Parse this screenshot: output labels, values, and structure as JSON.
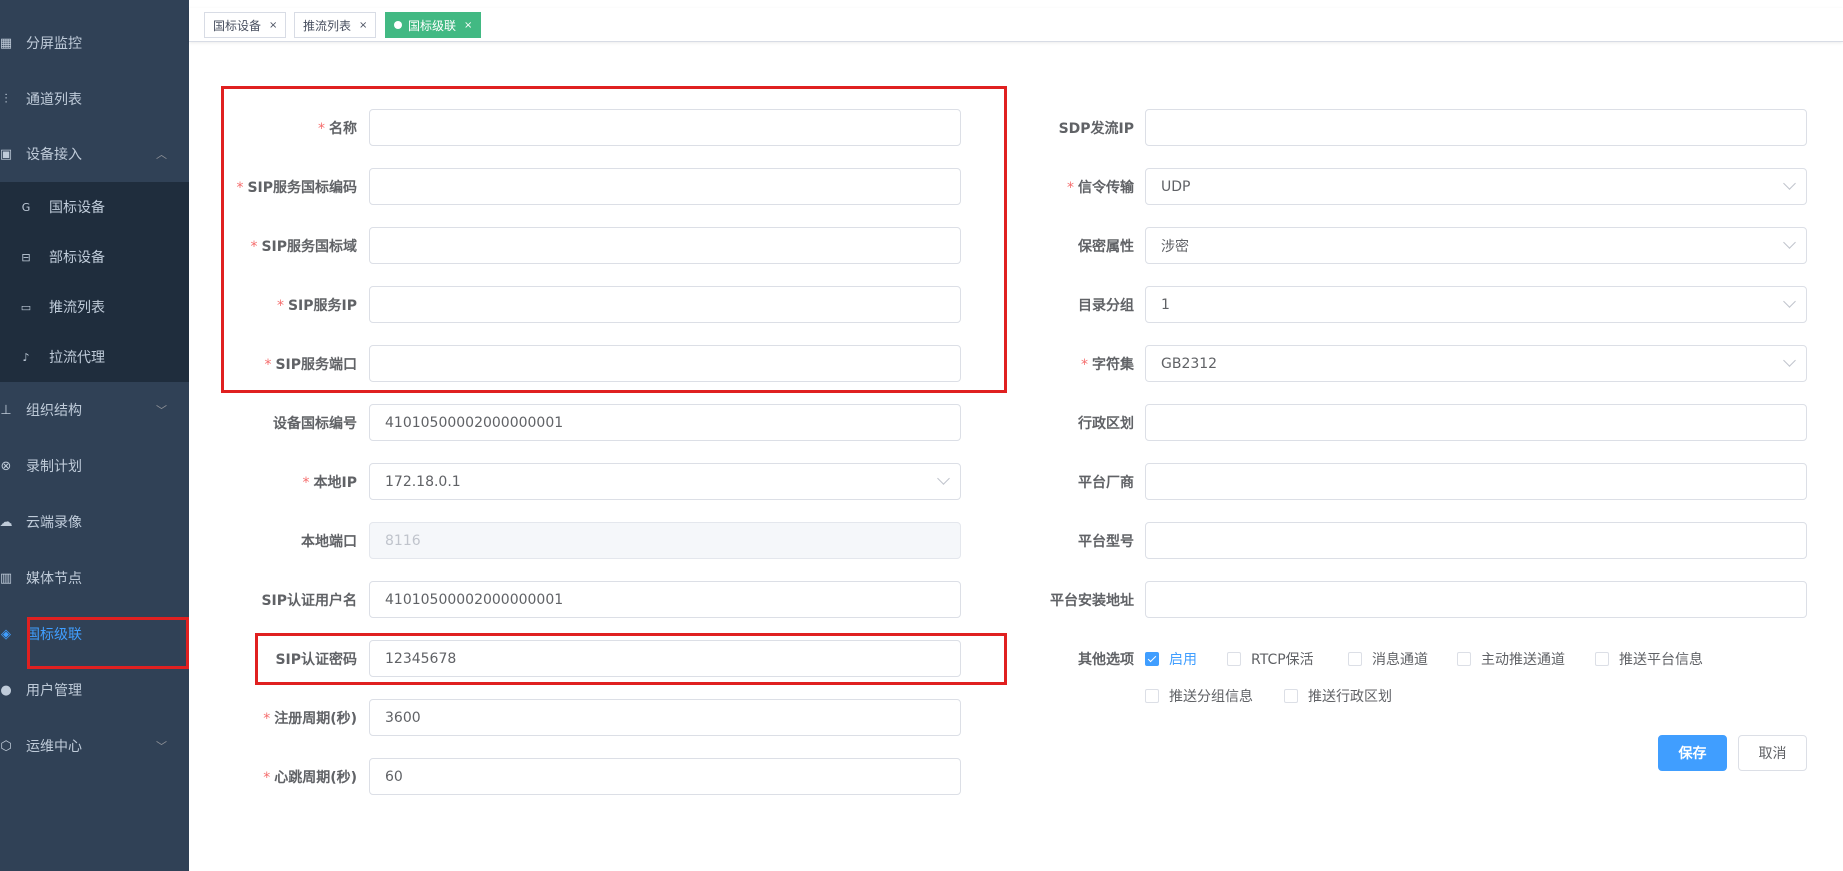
{
  "sidebar": {
    "items": [
      {
        "label": "分屏监控",
        "icon": "grid-icon"
      },
      {
        "label": "通道列表",
        "icon": "bars-icon"
      },
      {
        "label": "设备接入",
        "icon": "device-icon"
      },
      {
        "label": "组织结构",
        "icon": "tree-icon"
      },
      {
        "label": "录制计划",
        "icon": "record-icon"
      },
      {
        "label": "云端录像",
        "icon": "cloud-icon"
      },
      {
        "label": "媒体节点",
        "icon": "server-icon"
      },
      {
        "label": "国标级联",
        "icon": "layers-icon"
      },
      {
        "label": "用户管理",
        "icon": "user-icon"
      },
      {
        "label": "运维中心",
        "icon": "ops-icon"
      }
    ],
    "sub_items": [
      {
        "label": "国标设备",
        "icon": "g-icon"
      },
      {
        "label": "部标设备",
        "icon": "bus-icon"
      },
      {
        "label": "推流列表",
        "icon": "camera-icon"
      },
      {
        "label": "拉流代理",
        "icon": "proxy-icon"
      }
    ]
  },
  "tags": [
    {
      "label": "国标设备"
    },
    {
      "label": "推流列表"
    },
    {
      "label": "国标级联"
    }
  ],
  "form": {
    "left": {
      "name_label": "名称",
      "name_value": "",
      "sip_code_label": "SIP服务国标编码",
      "sip_code_value": "",
      "sip_domain_label": "SIP服务国标域",
      "sip_domain_value": "",
      "sip_ip_label": "SIP服务IP",
      "sip_ip_value": "",
      "sip_port_label": "SIP服务端口",
      "sip_port_value": "",
      "device_id_label": "设备国标编号",
      "device_id_value": "41010500002000000001",
      "local_ip_label": "本地IP",
      "local_ip_value": "172.18.0.1",
      "local_port_label": "本地端口",
      "local_port_value": "8116",
      "auth_user_label": "SIP认证用户名",
      "auth_user_value": "41010500002000000001",
      "auth_pwd_label": "SIP认证密码",
      "auth_pwd_value": "12345678",
      "reg_period_label": "注册周期(秒)",
      "reg_period_value": "3600",
      "heartbeat_label": "心跳周期(秒)",
      "heartbeat_value": "60"
    },
    "right": {
      "sdp_ip_label": "SDP发流IP",
      "sdp_ip_value": "",
      "transport_label": "信令传输",
      "transport_value": "UDP",
      "secrecy_label": "保密属性",
      "secrecy_value": "涉密",
      "catalog_group_label": "目录分组",
      "catalog_group_value": "1",
      "charset_label": "字符集",
      "charset_value": "GB2312",
      "admin_region_label": "行政区划",
      "admin_region_value": "",
      "vendor_label": "平台厂商",
      "vendor_value": "",
      "model_label": "平台型号",
      "model_value": "",
      "address_label": "平台安装地址",
      "address_value": "",
      "other_label": "其他选项",
      "options": [
        {
          "label": "启用",
          "checked": true
        },
        {
          "label": "RTCP保活",
          "checked": false
        },
        {
          "label": "消息通道",
          "checked": false
        },
        {
          "label": "主动推送通道",
          "checked": false
        },
        {
          "label": "推送平台信息",
          "checked": false
        },
        {
          "label": "推送分组信息",
          "checked": false
        },
        {
          "label": "推送行政区划",
          "checked": false
        }
      ]
    },
    "save_label": "保存",
    "cancel_label": "取消"
  },
  "colors": {
    "sidebar_bg": "#304156",
    "submenu_bg": "#1f2d3d",
    "accent": "#409eff",
    "tag_active": "#42b983",
    "required": "#f56c6c",
    "highlight_box": "#e02020"
  }
}
